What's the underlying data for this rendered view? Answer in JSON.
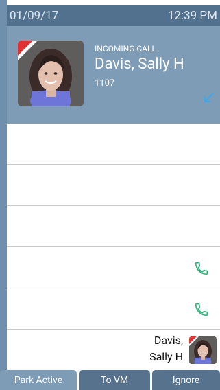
{
  "status_bar": {
    "date": "01/09/17",
    "time": "12:39 PM"
  },
  "incoming_call": {
    "label": "INCOMING CALL",
    "caller_name": "Davis, Sally H",
    "extension": "1107"
  },
  "lines": [
    {
      "type": "empty"
    },
    {
      "type": "empty"
    },
    {
      "type": "empty"
    },
    {
      "type": "phone",
      "icon": "phone-icon"
    },
    {
      "type": "phone",
      "icon": "phone-icon"
    },
    {
      "type": "contact",
      "name_line1": "Davis,",
      "name_line2": "Sally H"
    }
  ],
  "softkeys": [
    {
      "label": "Park Active"
    },
    {
      "label": "To VM"
    },
    {
      "label": "Ignore"
    }
  ],
  "colors": {
    "status_bar": "#52718f",
    "header": "#7f9cb6",
    "softkey": "#57728c",
    "accent_red": "#e03232",
    "phone_green": "#2db37a",
    "arrow_blue": "#3fa8e8"
  }
}
